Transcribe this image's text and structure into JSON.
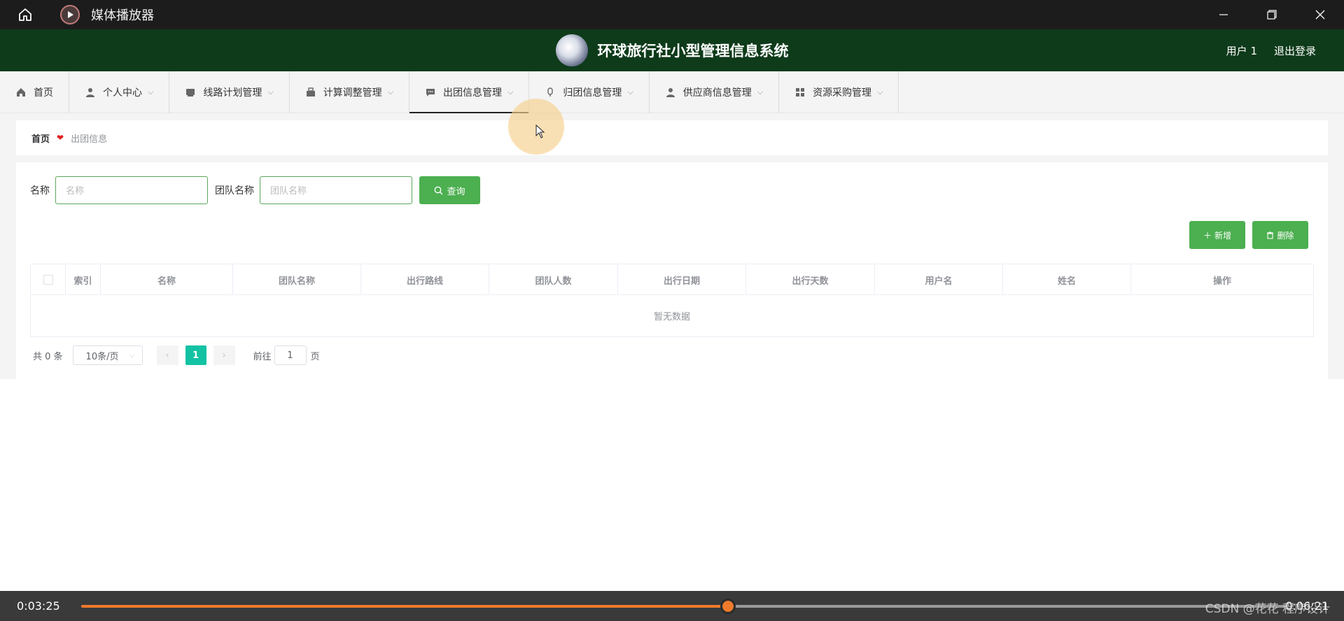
{
  "titlebar": {
    "title": "媒体播放器"
  },
  "header": {
    "system_title": "环球旅行社小型管理信息系统",
    "user_label": "用户 1",
    "logout_label": "退出登录"
  },
  "nav": {
    "items": [
      {
        "label": "首页",
        "icon": "home-icon",
        "has_dropdown": false
      },
      {
        "label": "个人中心",
        "icon": "user-icon",
        "has_dropdown": true
      },
      {
        "label": "线路计划管理",
        "icon": "route-icon",
        "has_dropdown": true
      },
      {
        "label": "计算调整管理",
        "icon": "calc-icon",
        "has_dropdown": true
      },
      {
        "label": "出团信息管理",
        "icon": "chat-icon",
        "has_dropdown": true,
        "active": true
      },
      {
        "label": "归团信息管理",
        "icon": "mic-icon",
        "has_dropdown": true
      },
      {
        "label": "供应商信息管理",
        "icon": "supplier-icon",
        "has_dropdown": true
      },
      {
        "label": "资源采购管理",
        "icon": "grid-icon",
        "has_dropdown": true
      }
    ]
  },
  "breadcrumb": {
    "home": "首页",
    "current": "出团信息"
  },
  "search": {
    "name_label": "名称",
    "name_placeholder": "名称",
    "team_label": "团队名称",
    "team_placeholder": "团队名称",
    "query_button": "查询"
  },
  "actions": {
    "add_button": "新增",
    "delete_button": "删除"
  },
  "table": {
    "columns": [
      "索引",
      "名称",
      "团队名称",
      "出行路线",
      "团队人数",
      "出行日期",
      "出行天数",
      "用户名",
      "姓名",
      "操作"
    ],
    "empty_text": "暂无数据"
  },
  "pagination": {
    "total_text": "共 0 条",
    "page_size": "10条/页",
    "current_page": "1",
    "goto_prefix": "前往",
    "goto_value": "1",
    "goto_suffix": "页"
  },
  "player": {
    "current_time": "0:03:25",
    "total_time": "0:06:21",
    "progress_fraction": 0.537
  },
  "watermark": "CSDN @花花 程序设计",
  "colors": {
    "header_bg": "#0e3b1a",
    "accent_green": "#4caf50",
    "page_active": "#13c2a3",
    "progress": "#f07a2c"
  }
}
